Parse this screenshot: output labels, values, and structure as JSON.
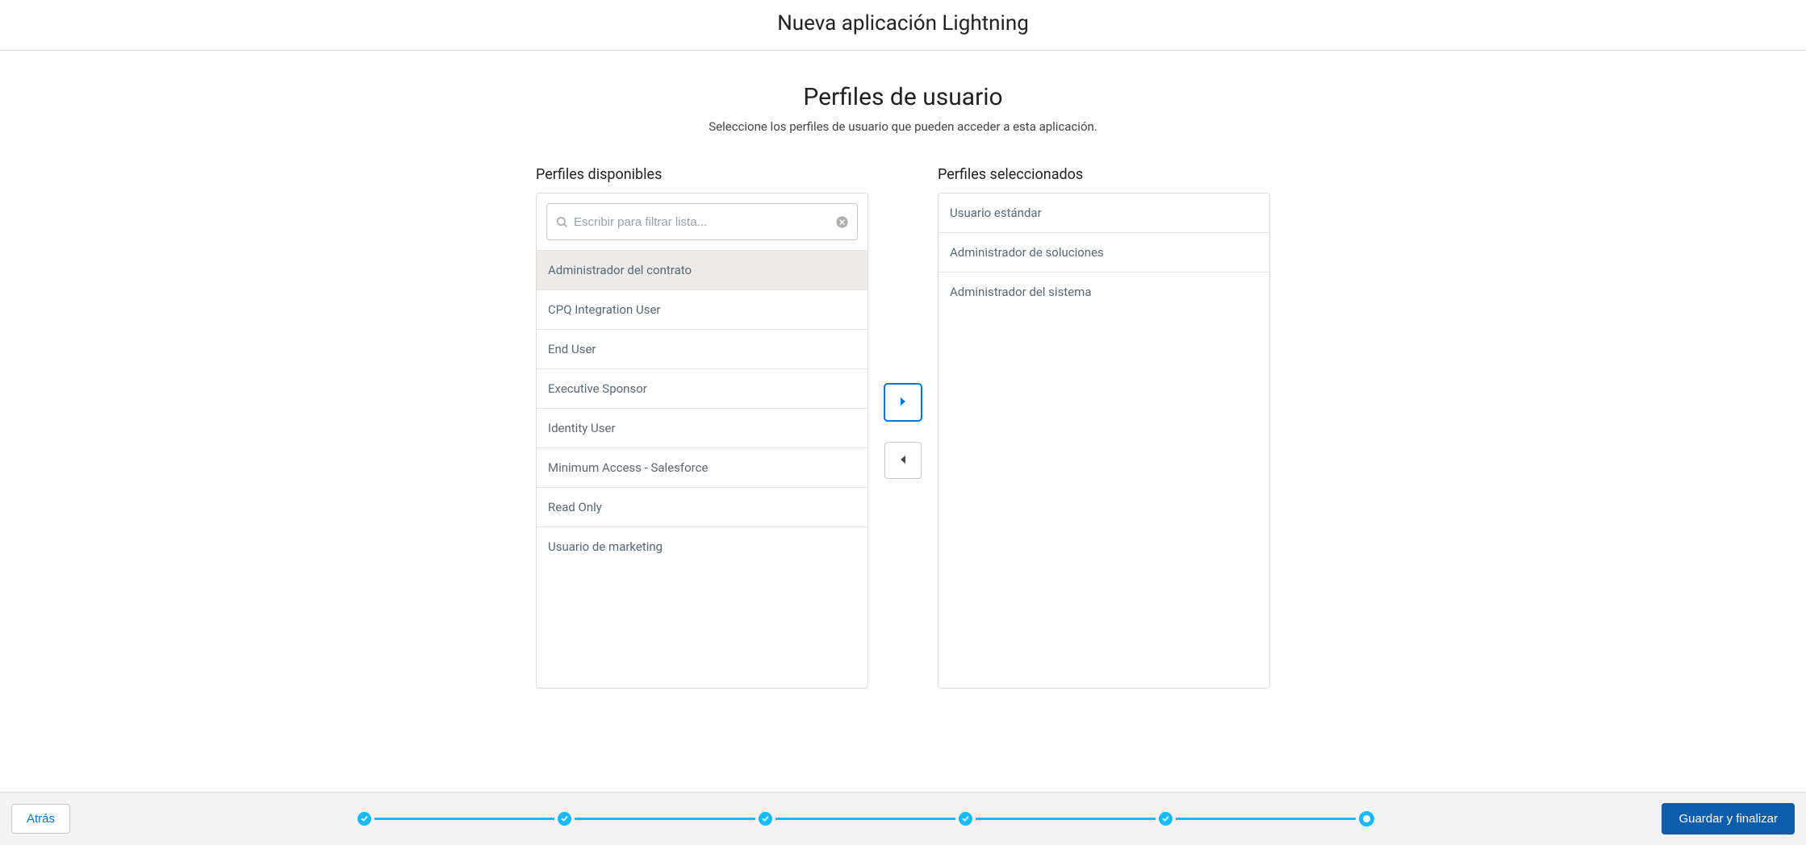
{
  "header": {
    "title": "Nueva aplicación Lightning"
  },
  "section": {
    "title": "Perfiles de usuario",
    "subtitle": "Seleccione los perfiles de usuario que pueden acceder a esta aplicación."
  },
  "available": {
    "label": "Perfiles disponibles",
    "search_placeholder": "Escribir para filtrar lista...",
    "items": [
      "Administrador del contrato",
      "CPQ Integration User",
      "End User",
      "Executive Sponsor",
      "Identity User",
      "Minimum Access - Salesforce",
      "Read Only",
      "Usuario de marketing"
    ],
    "highlighted_index": 0
  },
  "selected": {
    "label": "Perfiles seleccionados",
    "items": [
      "Usuario estándar",
      "Administrador de soluciones",
      "Administrador del sistema"
    ]
  },
  "footer": {
    "back_label": "Atrás",
    "save_label": "Guardar y finalizar",
    "steps_total": 6,
    "current_step": 6
  },
  "colors": {
    "progress": "#1ab9ff",
    "primary_button": "#0b5cab",
    "link": "#0176d3"
  }
}
